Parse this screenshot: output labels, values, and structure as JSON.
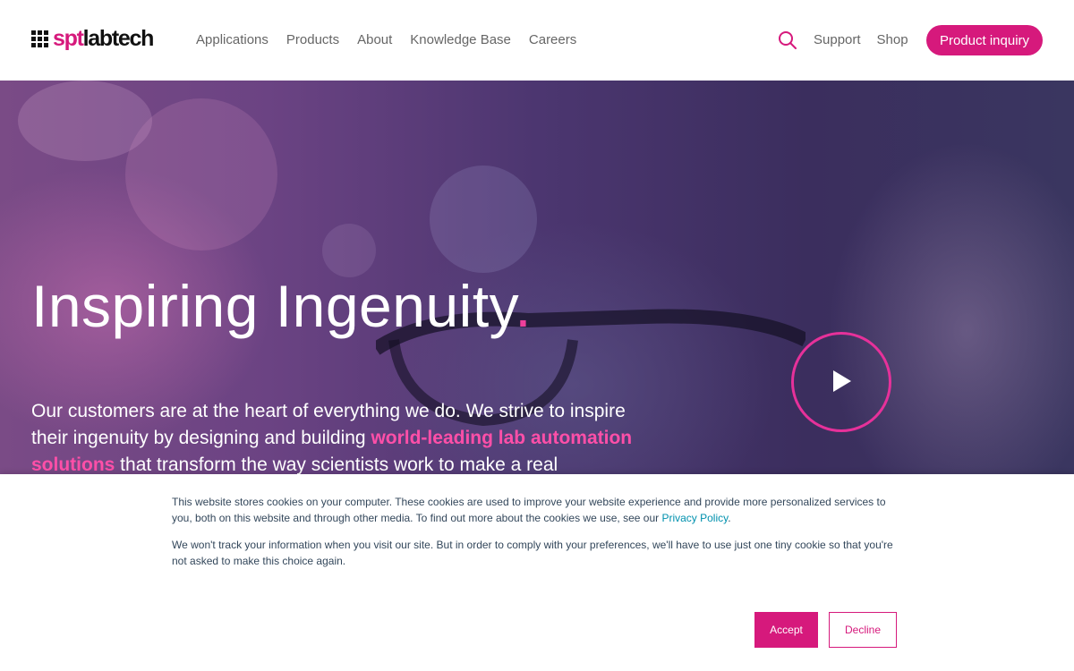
{
  "brand": {
    "logo_prefix": "spt",
    "logo_suffix": "labtech",
    "accent_color": "#d6197c"
  },
  "nav": {
    "items": [
      "Applications",
      "Products",
      "About",
      "Knowledge Base",
      "Careers"
    ],
    "search_icon": "search-icon",
    "support": "Support",
    "shop": "Shop",
    "inquiry": "Product inquiry"
  },
  "hero": {
    "title": "Inspiring Ingenuity",
    "title_dot": ".",
    "body_before": "Our customers are at the heart of everything we do. We strive to inspire their ingenuity by designing and building ",
    "body_highlight": "world-leading lab automation solutions",
    "body_after": " that transform the way scientists work to make a real",
    "play_icon": "play-icon"
  },
  "cookie": {
    "text1": "This website stores cookies on your computer. These cookies are used to improve your website experience and provide more personalized services to you, both on this website and through other media. To find out more about the cookies we use, see our ",
    "privacy_link": "Privacy Policy",
    "text1_end": ".",
    "text2": "We won't track your information when you visit our site. But in order to comply with your preferences, we'll have to use just one tiny cookie so that you're not asked to make this choice again.",
    "accept": "Accept",
    "decline": "Decline"
  }
}
